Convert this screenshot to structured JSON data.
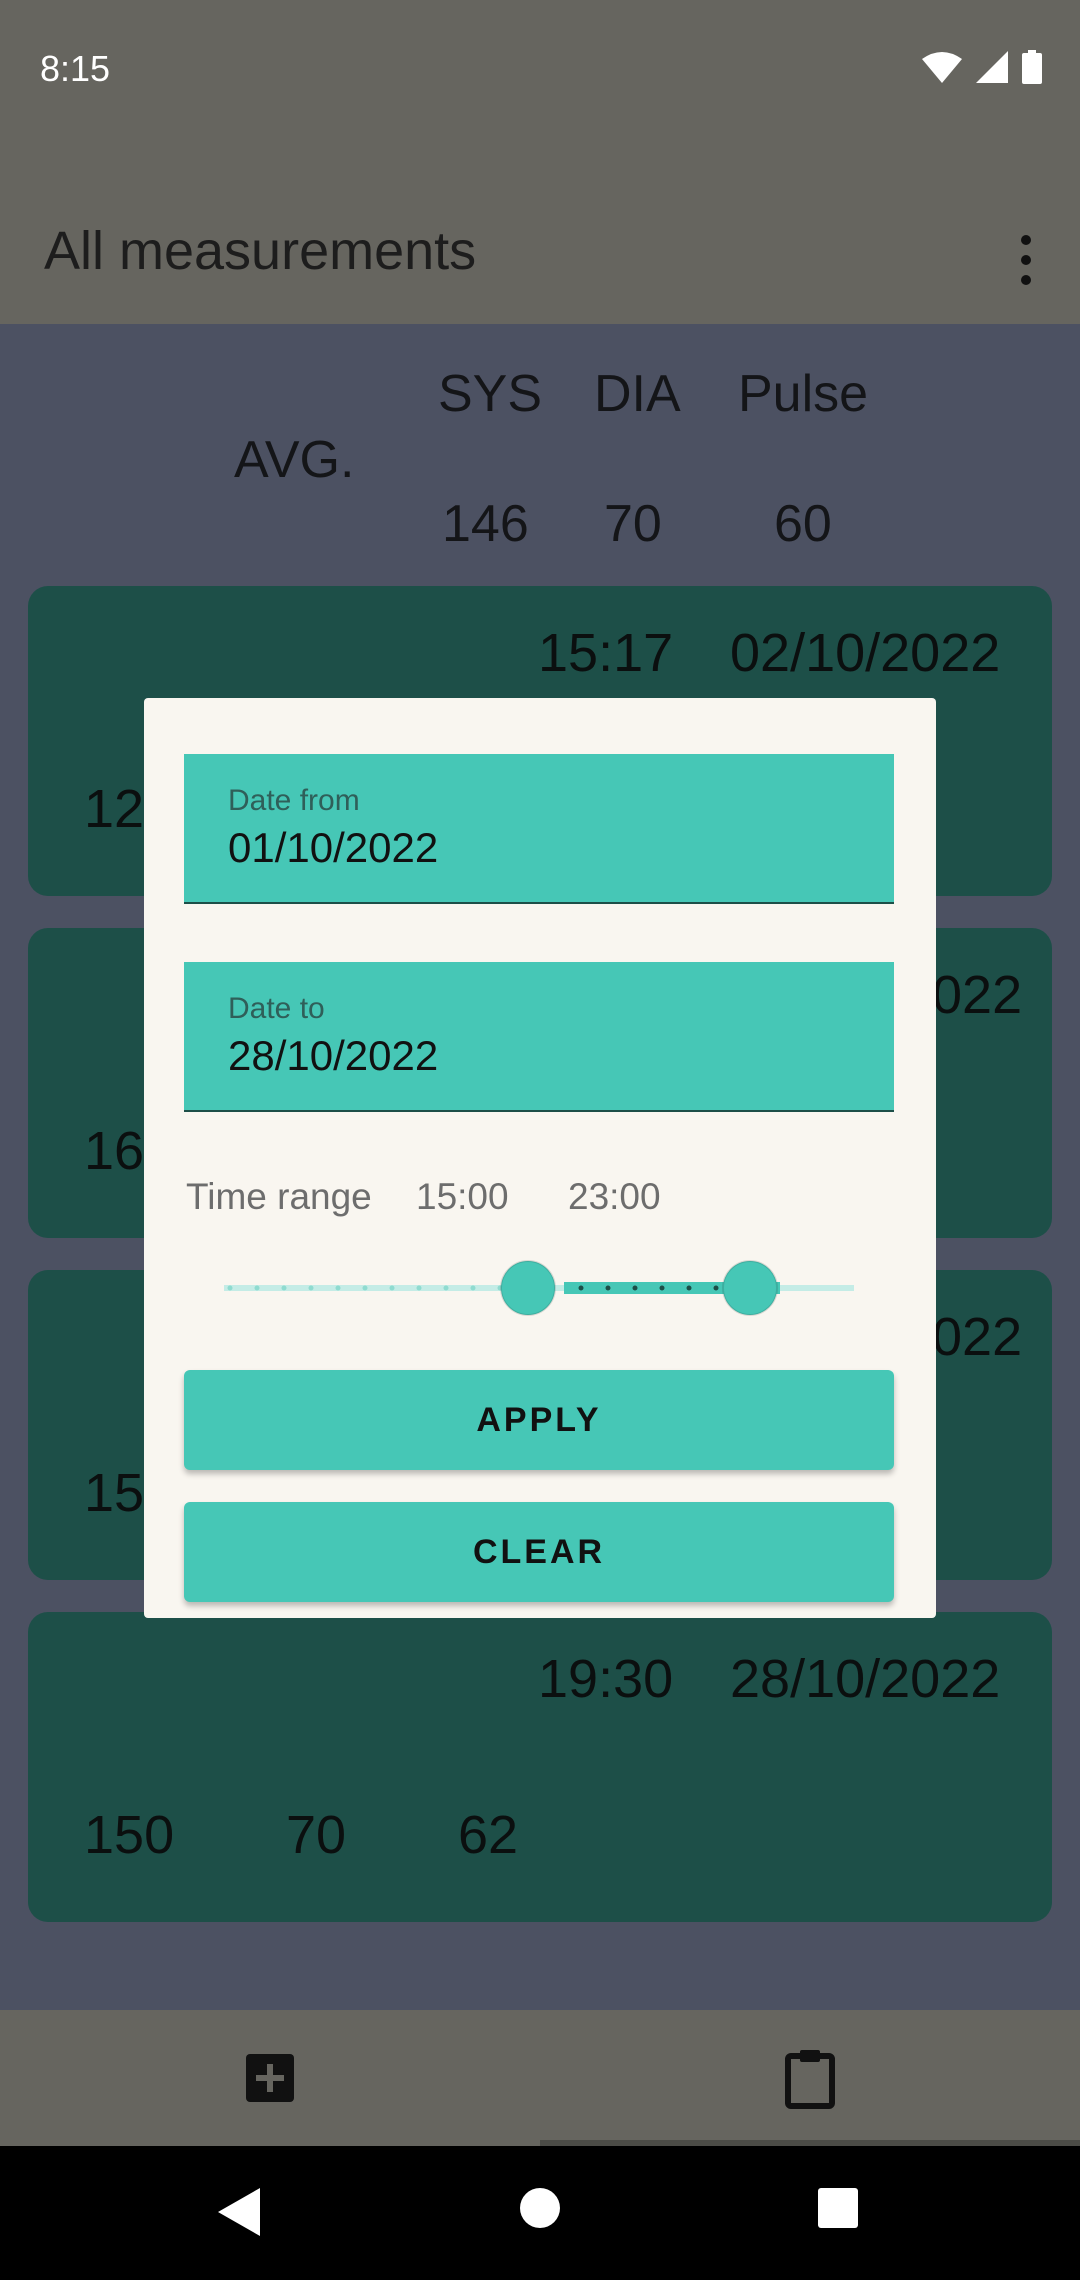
{
  "status_bar": {
    "time": "8:15"
  },
  "app_bar": {
    "title": "All measurements"
  },
  "averages": {
    "label": "AVG.",
    "headers": [
      "SYS",
      "DIA",
      "Pulse"
    ],
    "values": [
      "146",
      "70",
      "60"
    ]
  },
  "cards": [
    {
      "time": "15:17",
      "date": "02/10/2022",
      "sys": "12",
      "dia": "",
      "pulse": ""
    },
    {
      "time": "",
      "date": "022",
      "sys": "16",
      "dia": "",
      "pulse": ""
    },
    {
      "time": "",
      "date": "022",
      "sys": "15",
      "dia": "",
      "pulse": ""
    },
    {
      "time": "19:30",
      "date": "28/10/2022",
      "sys": "150",
      "dia": "70",
      "pulse": "62"
    }
  ],
  "filter_dialog": {
    "date_from_label": "Date from",
    "date_from_value": "01/10/2022",
    "date_to_label": "Date to",
    "date_to_value": "28/10/2022",
    "time_range_label": "Time range",
    "time_start": "15:00",
    "time_end": "23:00",
    "apply_label": "APPLY",
    "clear_label": "CLEAR"
  },
  "bottom_nav": {
    "items": [
      "add-box-icon",
      "clipboard-icon"
    ],
    "selected": 1
  },
  "colors": {
    "accent": "#46c7b6",
    "card": "#1d4f48",
    "dialog": "#f9f6f0"
  }
}
